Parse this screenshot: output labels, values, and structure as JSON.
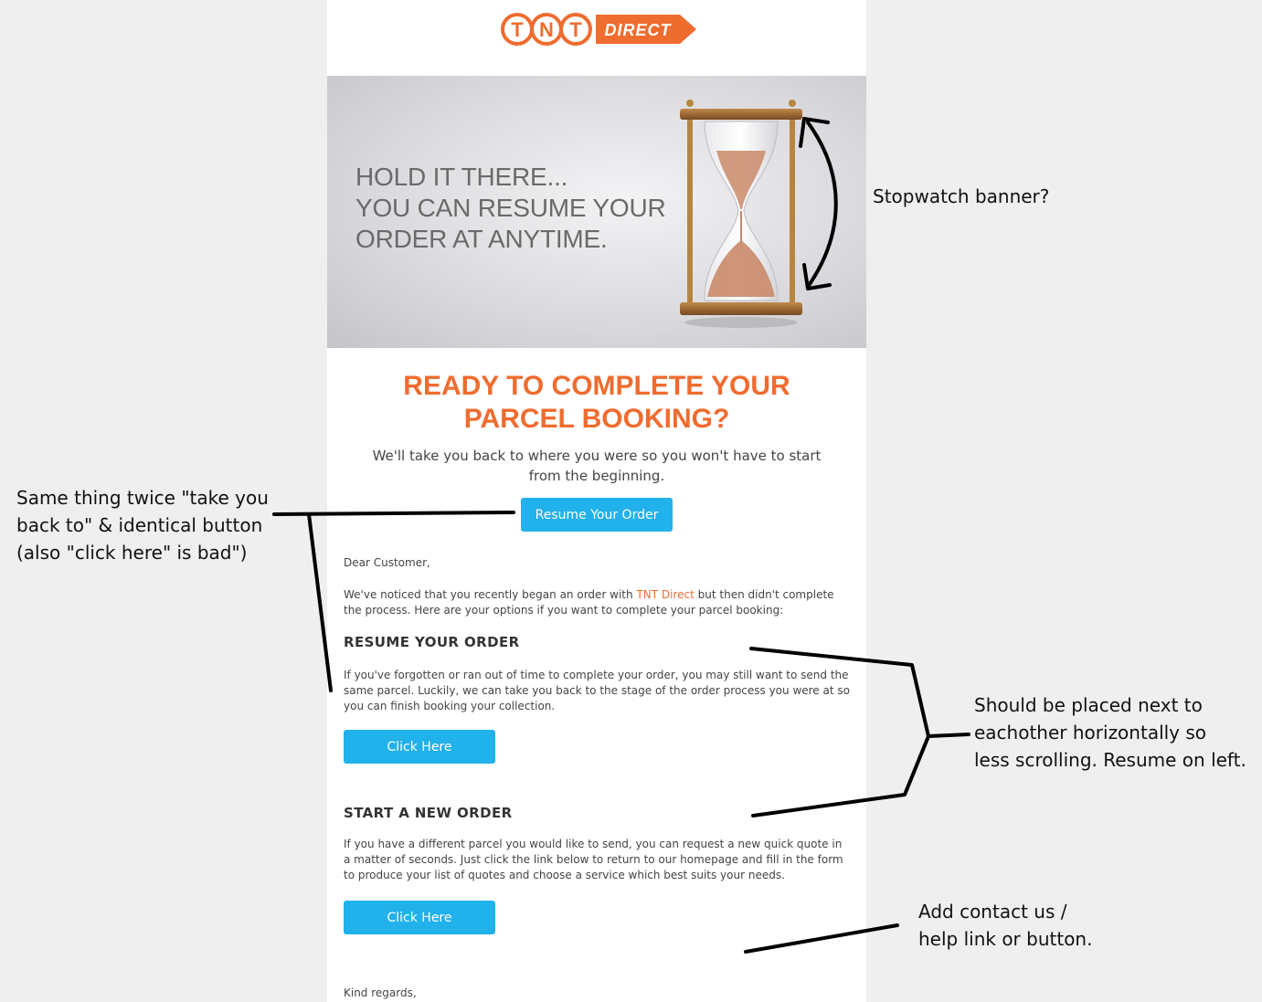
{
  "email": {
    "logo": {
      "left": "TNT",
      "right": "DIRECT"
    },
    "banner": {
      "lines": [
        "HOLD IT THERE...",
        "YOU CAN RESUME YOUR",
        "ORDER AT ANYTIME."
      ]
    },
    "headline": [
      "READY TO COMPLETE YOUR",
      "PARCEL BOOKING?"
    ],
    "subheadline": [
      "We'll take you back to where you were so you won't have to start",
      "from the beginning."
    ],
    "resume_button": "Resume Your Order",
    "greeting": "Dear Customer,",
    "intro": {
      "before": "We've noticed that you recently began an order with ",
      "link": "TNT Direct",
      "after": " but then didn't complete the process. Here are your options if you want to complete your parcel booking:"
    },
    "resume_section": {
      "title": "RESUME YOUR ORDER",
      "body": "If you've forgotten or ran out of time to complete your order, you may still want to send the same parcel. Luckily, we can take you back to the stage of the order process you were at so you can finish booking your collection.",
      "button": "Click Here"
    },
    "new_section": {
      "title": "START A NEW ORDER",
      "body": "If you have a different parcel you would like to send, you can request a new quick quote in a matter of seconds. Just click the link below to return to our homepage and fill in the form to produce your list of quotes and choose a service which best suits your needs.",
      "button": "Click Here"
    },
    "signoff": "Kind regards,"
  },
  "annotations": {
    "stopwatch": "Stopwatch banner?",
    "same_thing": [
      "Same thing twice \"take you",
      "back to\" & identical button",
      "(also \"click here\" is bad\")"
    ],
    "horizontal": [
      "Should be placed next to",
      "eachother horizontally so",
      "less scrolling. Resume on left."
    ],
    "contact": [
      "Add contact us /",
      "help link or button."
    ]
  },
  "colors": {
    "brand_orange": "#ef6c2f",
    "button_blue": "#21b1eb"
  }
}
